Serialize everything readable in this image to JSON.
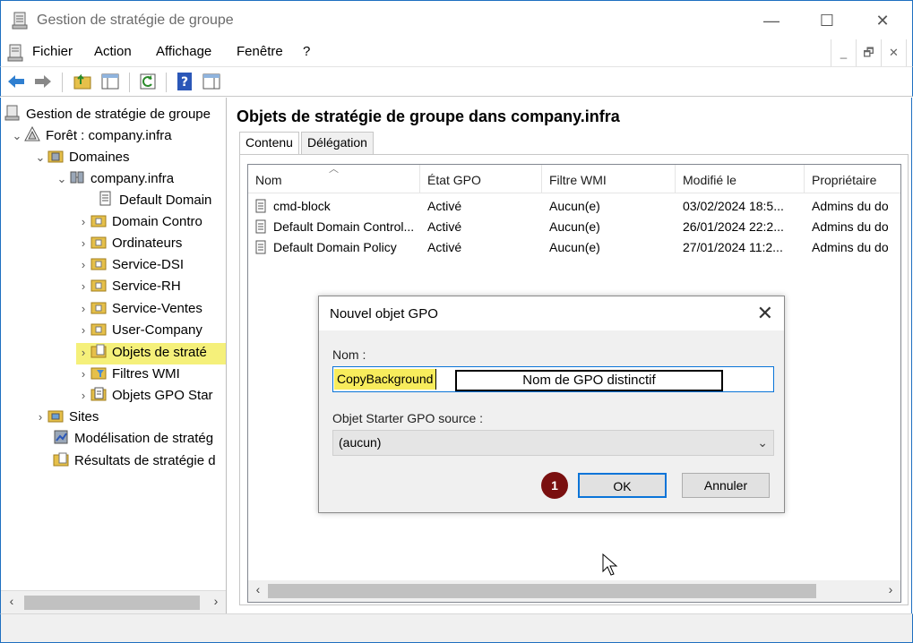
{
  "window": {
    "title": "Gestion de stratégie de groupe",
    "minimize_glyph": "—",
    "maximize_glyph": "☐",
    "close_glyph": "✕"
  },
  "menu": {
    "items": [
      "Fichier",
      "Action",
      "Affichage",
      "Fenêtre",
      "?"
    ],
    "mdi": [
      "_",
      "🗗",
      "✕"
    ]
  },
  "tree": {
    "root": "Gestion de stratégie de groupe",
    "forest": "Forêt : company.infra",
    "domains": "Domaines",
    "domain": "company.infra",
    "children": [
      "Default Domain",
      "Domain Contro",
      "Ordinateurs",
      "Service-DSI",
      "Service-RH",
      "Service-Ventes",
      "User-Company",
      "Objets de straté",
      "Filtres WMI",
      "Objets GPO Star"
    ],
    "sites": "Sites",
    "modeling": "Modélisation de stratég",
    "results": "Résultats de stratégie d"
  },
  "main": {
    "title": "Objets de stratégie de groupe dans company.infra",
    "tabs": [
      "Contenu",
      "Délégation"
    ],
    "columns": [
      "Nom",
      "État GPO",
      "Filtre WMI",
      "Modifié le",
      "Propriétaire"
    ],
    "rows": [
      [
        "cmd-block",
        "Activé",
        "Aucun(e)",
        "03/02/2024 18:5...",
        "Admins du do"
      ],
      [
        "Default Domain Control...",
        "Activé",
        "Aucun(e)",
        "26/01/2024 22:2...",
        "Admins du do"
      ],
      [
        "Default Domain Policy",
        "Activé",
        "Aucun(e)",
        "27/01/2024 11:2...",
        "Admins du do"
      ]
    ]
  },
  "dialog": {
    "title": "Nouvel objet GPO",
    "name_label": "Nom :",
    "name_value": "CopyBackground",
    "annotation": "Nom de GPO distinctif",
    "starter_label": "Objet Starter GPO source :",
    "starter_value": "(aucun)",
    "ok": "OK",
    "cancel": "Annuler",
    "step_badge": "1"
  },
  "colors": {
    "highlight": "#f5f07a",
    "badge": "#7a1010",
    "focus": "#0a74d8"
  }
}
